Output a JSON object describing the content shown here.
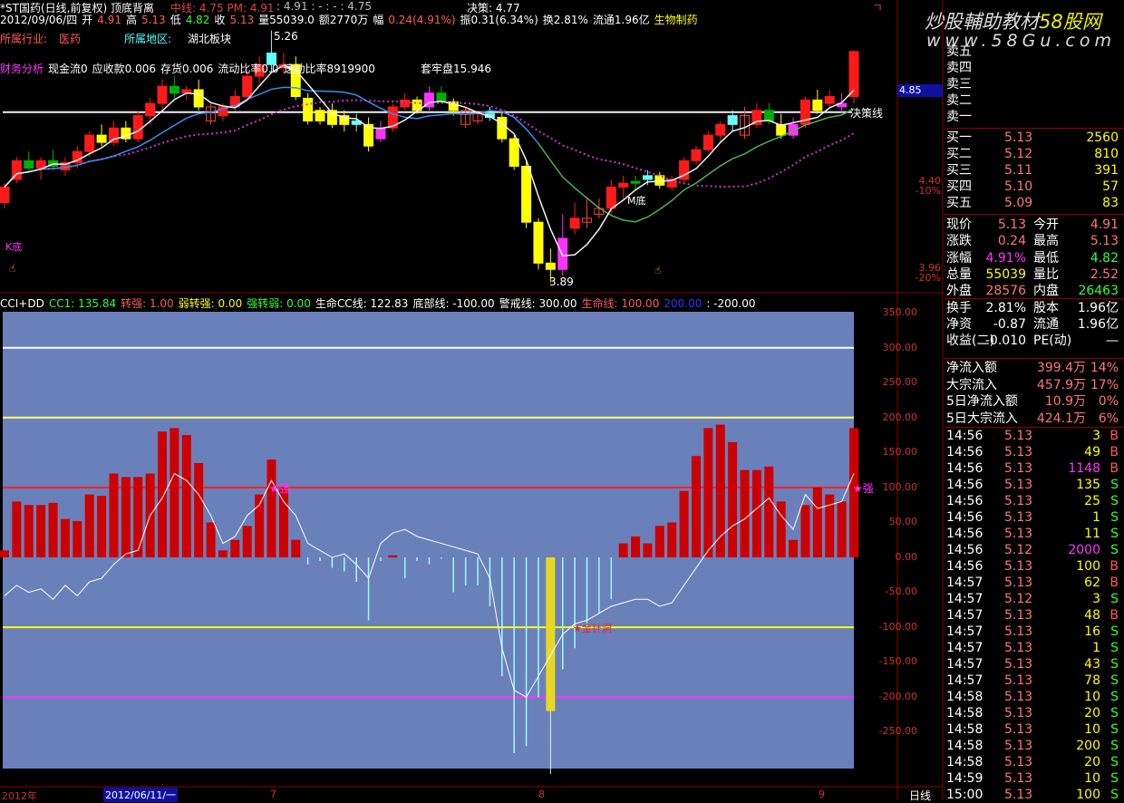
{
  "header": {
    "title": "*ST国药(日线,前复权) 顶底背离",
    "midline": "中线: 4.75 PM: 4.91",
    "ma_values": ": 4.91 : - : - : 4.75",
    "decision": "决策: 4.77",
    "info": [
      {
        "t": "2012/09/06/四",
        "c": "wht"
      },
      {
        "t": "开",
        "c": "wht"
      },
      {
        "t": "4.91",
        "c": "red"
      },
      {
        "t": "高",
        "c": "wht"
      },
      {
        "t": "5.13",
        "c": "red"
      },
      {
        "t": "低",
        "c": "wht"
      },
      {
        "t": "4.82",
        "c": "grn"
      },
      {
        "t": "收",
        "c": "wht"
      },
      {
        "t": "5.13",
        "c": "red"
      },
      {
        "t": "量55039.0",
        "c": "wht"
      },
      {
        "t": "额2770万",
        "c": "wht"
      },
      {
        "t": "幅",
        "c": "wht"
      },
      {
        "t": "0.24(4.91%)",
        "c": "red"
      },
      {
        "t": "振0.31(6.34%)",
        "c": "wht"
      },
      {
        "t": "换2.81%",
        "c": "wht"
      },
      {
        "t": "流通1.96亿",
        "c": "wht"
      },
      {
        "t": "生物制药",
        "c": "yel"
      }
    ],
    "industry_label": "所属行业:",
    "industry": "医药",
    "region_label": "所属地区:",
    "region": "湖北板块",
    "finance": [
      {
        "t": "财务分析",
        "c": "mag"
      },
      {
        "t": "现金流0",
        "c": "wht"
      },
      {
        "t": "应收款0.006",
        "c": "wht"
      },
      {
        "t": "存货0.006",
        "c": "wht"
      },
      {
        "t": "流动比率0.0",
        "c": "wht"
      },
      {
        "t": "速动比率8919900",
        "c": "wht"
      }
    ],
    "trapped": "套牢盘15.946"
  },
  "watermark": {
    "line1": "炒股輔助教材",
    "line1b": "58股网",
    "line2": "www.58Gu.com"
  },
  "price_chart": {
    "colors": {
      "r": "#ff1a1a",
      "g": "#00b000",
      "y": "#ffff00",
      "m": "#ff33ff",
      "c": "#66ffff",
      "h": "#ff4040"
    },
    "candles": [
      [
        4.28,
        4.38,
        4.25,
        4.36,
        "r"
      ],
      [
        4.4,
        4.52,
        4.38,
        4.5,
        "r"
      ],
      [
        4.5,
        4.55,
        4.44,
        4.46,
        "g"
      ],
      [
        4.46,
        4.52,
        4.4,
        4.5,
        "r"
      ],
      [
        4.5,
        4.56,
        4.45,
        4.47,
        "g"
      ],
      [
        4.45,
        4.52,
        4.42,
        4.49,
        "r"
      ],
      [
        4.49,
        4.58,
        4.46,
        4.55,
        "r"
      ],
      [
        4.55,
        4.66,
        4.52,
        4.64,
        "r"
      ],
      [
        4.64,
        4.7,
        4.58,
        4.6,
        "y"
      ],
      [
        4.6,
        4.72,
        4.58,
        4.68,
        "r"
      ],
      [
        4.68,
        4.72,
        4.6,
        4.62,
        "y"
      ],
      [
        4.62,
        4.78,
        4.6,
        4.75,
        "r"
      ],
      [
        4.75,
        4.85,
        4.7,
        4.82,
        "r"
      ],
      [
        4.82,
        4.96,
        4.78,
        4.92,
        "r"
      ],
      [
        4.92,
        4.98,
        4.85,
        4.88,
        "g"
      ],
      [
        4.88,
        4.92,
        4.84,
        4.9,
        "r"
      ],
      [
        4.9,
        4.96,
        4.78,
        4.8,
        "y"
      ],
      [
        4.8,
        4.82,
        4.7,
        4.72,
        "h"
      ],
      [
        4.75,
        4.82,
        4.72,
        4.8,
        "r"
      ],
      [
        4.8,
        4.9,
        4.78,
        4.86,
        "r"
      ],
      [
        4.86,
        5.02,
        4.84,
        4.98,
        "r"
      ],
      [
        4.98,
        5.1,
        4.94,
        5.05,
        "r"
      ],
      [
        5.05,
        5.26,
        5.0,
        5.12,
        "c"
      ],
      [
        5.05,
        5.12,
        5.0,
        5.03,
        "r"
      ],
      [
        5.05,
        5.1,
        4.84,
        4.86,
        "y"
      ],
      [
        4.85,
        4.88,
        4.7,
        4.72,
        "y"
      ],
      [
        4.72,
        4.8,
        4.7,
        4.78,
        "y"
      ],
      [
        4.78,
        4.82,
        4.68,
        4.7,
        "y"
      ],
      [
        4.7,
        4.78,
        4.66,
        4.75,
        "y"
      ],
      [
        4.72,
        4.76,
        4.66,
        4.7,
        "c"
      ],
      [
        4.7,
        4.74,
        4.55,
        4.58,
        "y"
      ],
      [
        4.62,
        4.72,
        4.6,
        4.68,
        "m"
      ],
      [
        4.68,
        4.82,
        4.66,
        4.8,
        "r"
      ],
      [
        4.8,
        4.88,
        4.78,
        4.84,
        "r"
      ],
      [
        4.84,
        4.86,
        4.76,
        4.78,
        "y"
      ],
      [
        4.8,
        4.92,
        4.78,
        4.88,
        "m"
      ],
      [
        4.88,
        4.92,
        4.82,
        4.83,
        "g"
      ],
      [
        4.83,
        4.85,
        4.75,
        4.78,
        "y"
      ],
      [
        4.78,
        4.8,
        4.68,
        4.7,
        "h"
      ],
      [
        4.72,
        4.78,
        4.7,
        4.76,
        "h"
      ],
      [
        4.76,
        4.8,
        4.72,
        4.74,
        "c"
      ],
      [
        4.74,
        4.78,
        4.6,
        4.62,
        "y"
      ],
      [
        4.62,
        4.64,
        4.45,
        4.47,
        "y"
      ],
      [
        4.47,
        4.5,
        4.15,
        4.18,
        "y"
      ],
      [
        4.18,
        4.2,
        3.95,
        3.98,
        "y"
      ],
      [
        3.98,
        4.05,
        3.89,
        3.95,
        "y"
      ],
      [
        4.1,
        4.22,
        3.92,
        3.95,
        "m"
      ],
      [
        4.15,
        4.28,
        4.12,
        4.2,
        "r"
      ],
      [
        4.2,
        4.3,
        4.15,
        4.18,
        "h"
      ],
      [
        4.22,
        4.3,
        4.2,
        4.25,
        "h"
      ],
      [
        4.25,
        4.4,
        4.22,
        4.36,
        "r"
      ],
      [
        4.36,
        4.42,
        4.3,
        4.38,
        "r"
      ],
      [
        4.38,
        4.42,
        4.34,
        4.39,
        "g"
      ],
      [
        4.4,
        4.45,
        4.37,
        4.42,
        "c"
      ],
      [
        4.42,
        4.44,
        4.35,
        4.37,
        "y"
      ],
      [
        4.36,
        4.42,
        4.34,
        4.4,
        "r"
      ],
      [
        4.4,
        4.52,
        4.38,
        4.5,
        "r"
      ],
      [
        4.5,
        4.58,
        4.48,
        4.56,
        "r"
      ],
      [
        4.56,
        4.66,
        4.55,
        4.64,
        "r"
      ],
      [
        4.64,
        4.72,
        4.6,
        4.7,
        "r"
      ],
      [
        4.7,
        4.78,
        4.66,
        4.75,
        "c"
      ],
      [
        4.75,
        4.8,
        4.62,
        4.64,
        "h"
      ],
      [
        4.7,
        4.82,
        4.68,
        4.78,
        "r"
      ],
      [
        4.78,
        4.82,
        4.7,
        4.72,
        "g"
      ],
      [
        4.7,
        4.76,
        4.62,
        4.64,
        "y"
      ],
      [
        4.64,
        4.74,
        4.62,
        4.7,
        "m"
      ],
      [
        4.7,
        4.86,
        4.68,
        4.84,
        "r"
      ],
      [
        4.84,
        4.9,
        4.76,
        4.78,
        "y"
      ],
      [
        4.82,
        4.9,
        4.8,
        4.86,
        "r"
      ],
      [
        4.8,
        4.88,
        4.76,
        4.82,
        "m"
      ],
      [
        4.86,
        5.13,
        4.82,
        5.13,
        "r"
      ]
    ],
    "decision_price": 4.77,
    "decision_label": "决策线",
    "high_label": "5.26",
    "low_label": "3.89",
    "k_bottom_label": "K底",
    "m_bottom_label": "M底",
    "axis": [
      {
        "v": "4.85",
        "p": ""
      },
      {
        "v": "4.40",
        "p": "-10%"
      },
      {
        "v": "3.96",
        "p": "-20%"
      }
    ]
  },
  "cci": {
    "header": [
      {
        "t": "CCI+DD",
        "c": "wht"
      },
      {
        "t": "CC1: 135.84",
        "c": "grn"
      },
      {
        "t": "转强: 1.00",
        "c": "red"
      },
      {
        "t": "弱转强: 0.00",
        "c": "yel"
      },
      {
        "t": "强转弱: 0.00",
        "c": "grn"
      },
      {
        "t": "生命CC线: 122.83",
        "c": "wht"
      },
      {
        "t": "底部线: -100.00",
        "c": "wht"
      },
      {
        "t": "警戒线: 300.00",
        "c": "wht"
      },
      {
        "t": "生命线: 100.00",
        "c": "red"
      },
      {
        "t": "200.00",
        "c": "blue"
      },
      {
        "t": ": -200.00",
        "c": "wht"
      }
    ],
    "bars": [
      10,
      80,
      75,
      75,
      78,
      55,
      52,
      90,
      88,
      120,
      115,
      115,
      120,
      180,
      185,
      175,
      135,
      50,
      10,
      25,
      45,
      90,
      140,
      100,
      25,
      -10,
      -5,
      -15,
      -20,
      -35,
      -90,
      -5,
      3,
      -30,
      -5,
      -10,
      -2,
      -50,
      -40,
      -40,
      -70,
      -170,
      -280,
      -270,
      -200,
      -220,
      -160,
      -130,
      -100,
      -80,
      -60,
      20,
      30,
      20,
      45,
      50,
      95,
      145,
      185,
      190,
      165,
      125,
      125,
      130,
      80,
      25,
      75,
      100,
      90,
      80,
      185
    ],
    "bar_min_line": -310,
    "line": [
      -55,
      -40,
      -50,
      -45,
      -60,
      -40,
      -55,
      -35,
      -30,
      -10,
      5,
      10,
      60,
      85,
      120,
      110,
      90,
      60,
      20,
      30,
      60,
      75,
      110,
      80,
      60,
      20,
      10,
      0,
      5,
      -10,
      -30,
      20,
      35,
      40,
      30,
      25,
      20,
      15,
      10,
      5,
      -30,
      -130,
      -190,
      -200,
      -170,
      -140,
      -110,
      -95,
      -90,
      -80,
      -70,
      -65,
      -60,
      -60,
      -70,
      -65,
      -40,
      -15,
      10,
      30,
      45,
      55,
      70,
      85,
      60,
      40,
      90,
      70,
      75,
      80,
      120
    ],
    "levels": [
      {
        "v": 300,
        "c": "#ffffff"
      },
      {
        "v": 200,
        "c": "#ffff66"
      },
      {
        "v": 100,
        "c": "#ff2020"
      },
      {
        "v": -100,
        "c": "#ffff00"
      },
      {
        "v": -200,
        "c": "#ff33ff"
      }
    ],
    "strong_label": "★强",
    "gold_label": "★金针洞",
    "axis": [
      "350.00",
      "300.00",
      "250.00",
      "200.00",
      "150.00",
      "100.00",
      "50.00",
      "0.00",
      "-50.00",
      "-100.00",
      "-150.00",
      "-200.00",
      "-250.00"
    ]
  },
  "time_axis": {
    "year": "2012年",
    "cursor": "2012/06/11/一",
    "months": [
      "7",
      "8",
      "9"
    ],
    "period": "日线"
  },
  "orderbook": {
    "sell": [
      "卖五",
      "卖四",
      "卖三",
      "卖二",
      "卖一"
    ],
    "buy": [
      {
        "l": "买一",
        "p": "5.13",
        "v": "2560"
      },
      {
        "l": "买二",
        "p": "5.12",
        "v": "810"
      },
      {
        "l": "买三",
        "p": "5.11",
        "v": "391"
      },
      {
        "l": "买四",
        "p": "5.10",
        "v": "57"
      },
      {
        "l": "买五",
        "p": "5.09",
        "v": "83"
      }
    ]
  },
  "quote": [
    {
      "l1": "现价",
      "v1": "5.13",
      "c1": "pink",
      "l2": "今开",
      "v2": "4.91",
      "c2": "pink"
    },
    {
      "l1": "涨跌",
      "v1": "0.24",
      "c1": "pink",
      "l2": "最高",
      "v2": "5.13",
      "c2": "pink"
    },
    {
      "l1": "涨幅",
      "v1": "4.91%",
      "c1": "mag",
      "l2": "最低",
      "v2": "4.82",
      "c2": "grn"
    },
    {
      "l1": "总量",
      "v1": "55039",
      "c1": "yel",
      "l2": "量比",
      "v2": "2.52",
      "c2": "pink"
    },
    {
      "l1": "外盘",
      "v1": "28576",
      "c1": "pink",
      "l2": "内盘",
      "v2": "26463",
      "c2": "grn"
    },
    {
      "l1": "换手",
      "v1": "2.81%",
      "c1": "wht",
      "l2": "股本",
      "v2": "1.96亿",
      "c2": "wht"
    },
    {
      "l1": "净资",
      "v1": "-0.87",
      "c1": "wht",
      "l2": "流通",
      "v2": "1.96亿",
      "c2": "wht"
    },
    {
      "l1": "收益(二)",
      "v1": "-0.010",
      "c1": "wht",
      "l2": "PE(动)",
      "v2": "—",
      "c2": "wht"
    }
  ],
  "flows": [
    {
      "l": "净流入额",
      "v": "399.4万",
      "p": "14%"
    },
    {
      "l": "大宗流入",
      "v": "457.9万",
      "p": "17%"
    },
    {
      "l": "5日净流入额",
      "v": "10.9万",
      "p": "0%"
    },
    {
      "l": "5日大宗流入",
      "v": "424.1万",
      "p": "6%"
    }
  ],
  "trades": [
    [
      "14:56",
      "5.13",
      "3",
      "B"
    ],
    [
      "14:56",
      "5.13",
      "49",
      "B"
    ],
    [
      "14:56",
      "5.13",
      "1148",
      "B"
    ],
    [
      "14:56",
      "5.13",
      "135",
      "S"
    ],
    [
      "14:56",
      "5.13",
      "25",
      "S"
    ],
    [
      "14:56",
      "5.13",
      "1",
      "S"
    ],
    [
      "14:56",
      "5.13",
      "11",
      "S"
    ],
    [
      "14:56",
      "5.12",
      "2000",
      "S"
    ],
    [
      "14:56",
      "5.13",
      "100",
      "B"
    ],
    [
      "14:57",
      "5.13",
      "62",
      "B"
    ],
    [
      "14:57",
      "5.12",
      "3",
      "S"
    ],
    [
      "14:57",
      "5.13",
      "48",
      "B"
    ],
    [
      "14:57",
      "5.13",
      "16",
      "S"
    ],
    [
      "14:57",
      "5.13",
      "1",
      "S"
    ],
    [
      "14:57",
      "5.13",
      "43",
      "S"
    ],
    [
      "14:57",
      "5.13",
      "78",
      "S"
    ],
    [
      "14:58",
      "5.13",
      "10",
      "S"
    ],
    [
      "14:58",
      "5.13",
      "20",
      "S"
    ],
    [
      "14:58",
      "5.13",
      "10",
      "S"
    ],
    [
      "14:58",
      "5.13",
      "200",
      "S"
    ],
    [
      "14:58",
      "5.13",
      "20",
      "S"
    ],
    [
      "14:59",
      "5.13",
      "10",
      "S"
    ],
    [
      "15:00",
      "5.13",
      "100",
      "S"
    ]
  ]
}
